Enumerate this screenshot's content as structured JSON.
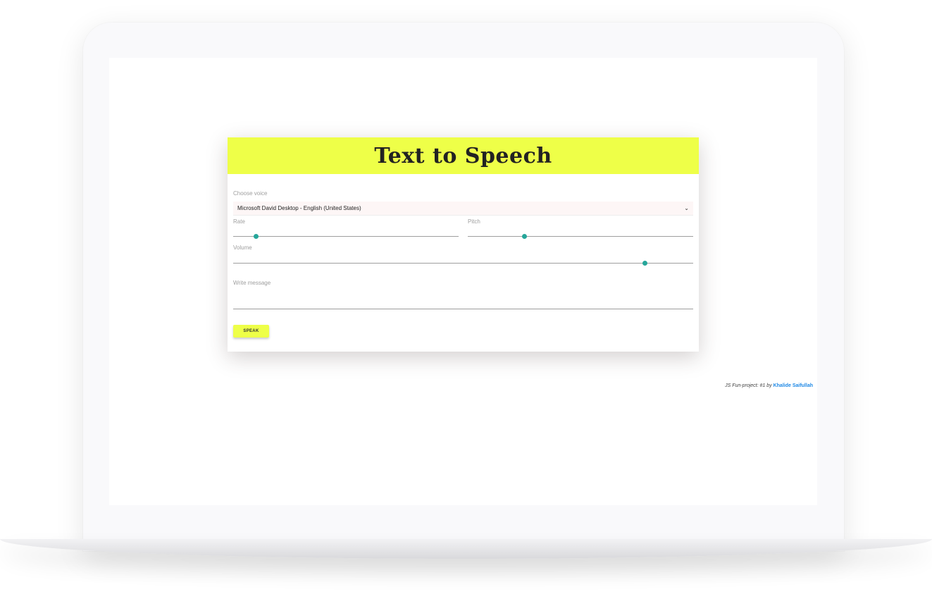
{
  "app": {
    "title": "Text to Speech",
    "header_color": "#eeff48",
    "accent_color": "#26a69a"
  },
  "voice": {
    "label": "Choose voice",
    "selected": "Microsoft David Desktop - English (United States)"
  },
  "rate": {
    "label": "Rate",
    "value_fraction": 0.1
  },
  "pitch": {
    "label": "Pitch",
    "value_fraction": 0.25
  },
  "volume": {
    "label": "Volume",
    "value_fraction": 0.895
  },
  "message": {
    "placeholder": "Write message"
  },
  "speak_button": {
    "label": "SPEAK"
  },
  "footer": {
    "credit_prefix": "JS Fun-project: #1 by",
    "author": "Khalide Saifullah"
  }
}
